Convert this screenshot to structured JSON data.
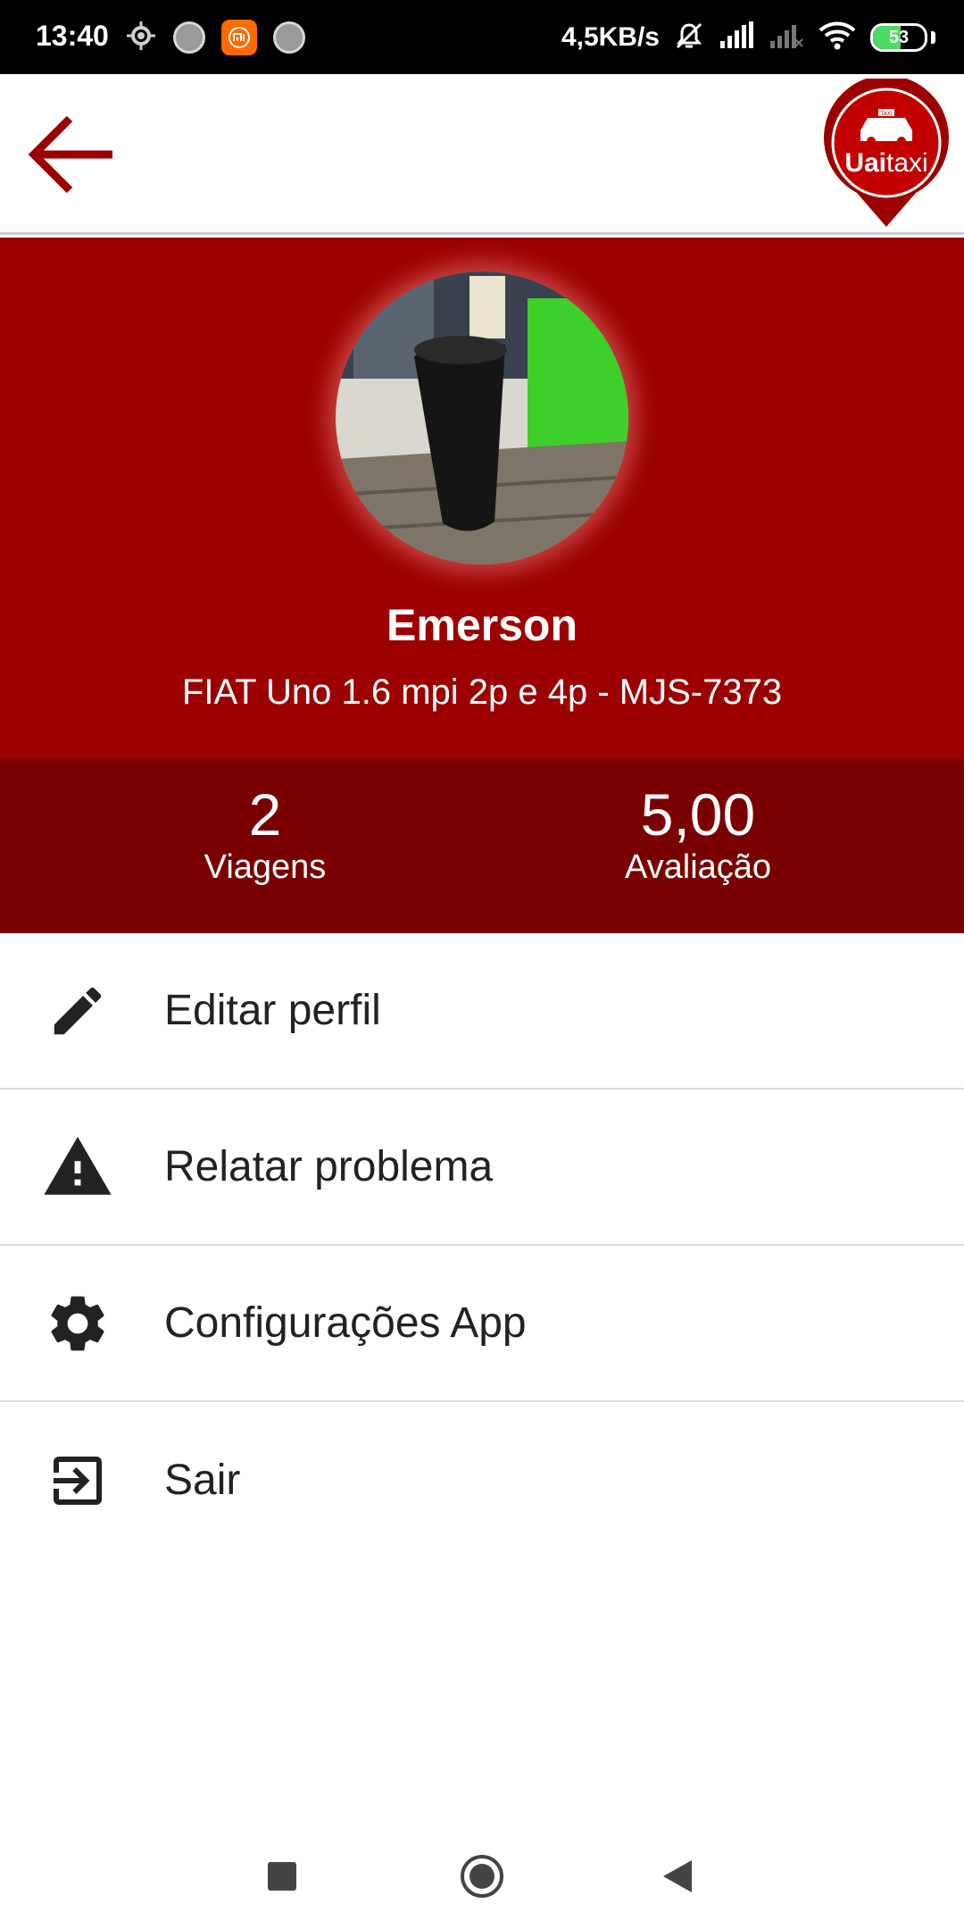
{
  "status_bar": {
    "time": "13:40",
    "network_speed": "4,5KB/s",
    "battery_level": "53",
    "battery_fraction": 0.53,
    "icons_left": [
      "location-icon",
      "app-dot-icon",
      "mi-icon",
      "app-dot-icon"
    ],
    "icons_right": [
      "alarm-off-icon",
      "signal-icon",
      "signal-weak-icon",
      "wifi-icon",
      "battery-icon"
    ]
  },
  "top_bar": {
    "back_icon": "arrow-left-icon",
    "logo": {
      "text_bold": "Uai",
      "text_light": "taxi",
      "badge": "TAXI"
    }
  },
  "profile": {
    "name": "Emerson",
    "vehicle": "FIAT Uno 1.6 mpi 2p e 4p - MJS-7373"
  },
  "stats": {
    "trips": {
      "value": "2",
      "label": "Viagens"
    },
    "rating": {
      "value": "5,00",
      "label": "Avaliação"
    }
  },
  "menu": {
    "items": [
      {
        "label": "Editar perfil",
        "icon": "pencil-icon"
      },
      {
        "label": "Relatar problema",
        "icon": "warning-icon"
      },
      {
        "label": "Configurações App",
        "icon": "gear-icon"
      },
      {
        "label": "Sair",
        "icon": "logout-icon"
      }
    ]
  },
  "nav_bar": {
    "icons": [
      "recents-icon",
      "home-icon",
      "back-icon"
    ]
  },
  "colors": {
    "primary": "#9c0000",
    "primary_dark": "#7a0101",
    "battery_green": "#4cd964",
    "mi_orange": "#ff6a00"
  }
}
